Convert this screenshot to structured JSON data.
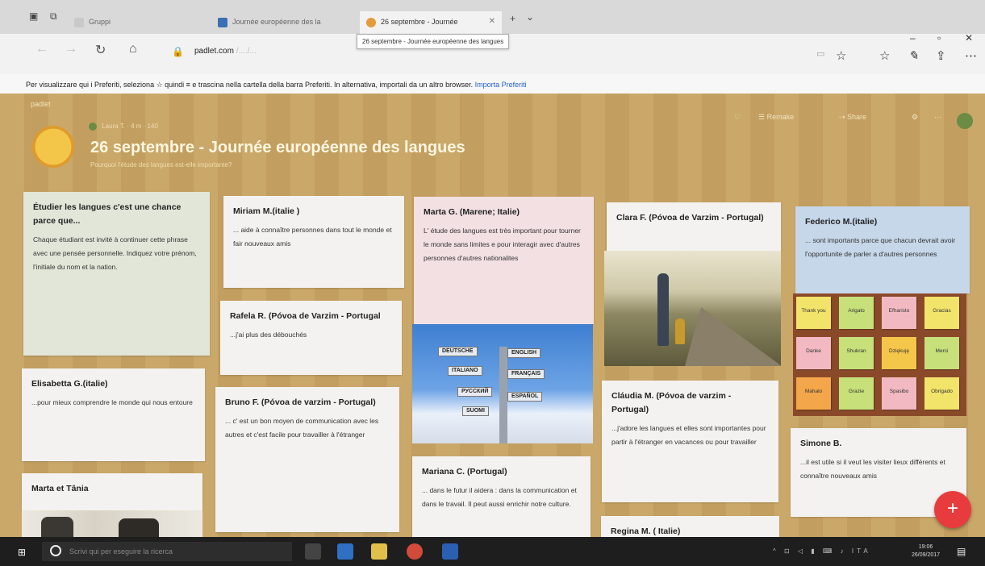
{
  "browser": {
    "tabs": [
      {
        "label": "Gruppi",
        "color": "#c9c9c9"
      },
      {
        "label": "Journée européenne des la",
        "color": "#3a6fb5"
      },
      {
        "label": "26 septembre - Journée",
        "color": "#e39b3b"
      }
    ],
    "tooltip": "26 septembre - Journée européenne des langues",
    "url_domain": "padlet.com",
    "url_path": "/..../...",
    "favorites_notice": "Per visualizzare qui i Preferiti, seleziona  ☆  quindi  ≡  e trascina nella cartella della barra Preferiti. In alternativa, importali da un altro browser.",
    "favorites_link": "Importa Preferiti"
  },
  "padlet": {
    "brand": "padlet",
    "author": "Laura T. · 4 m · 140",
    "title": "26 septembre - Journée européenne des langues",
    "subtitle": "Pourquoi l'étude des langues est-elle importante?",
    "tools": [
      "♡",
      "☰ Remake",
      "⇢ Share",
      "⚙",
      "⋯"
    ],
    "background_color": "#c8a463",
    "posts": {
      "intro": {
        "title": "Étudier les langues c'est une chance parce que...",
        "body": "Chaque étudiant est invité à continuer cette phrase avec une pensée personnelle. Indiquez votre prénom, l'initiale du nom et la nation."
      },
      "elisabetta": {
        "title": "Elisabetta G.(italie)",
        "body": "...pour mieux comprendre le monde qui nous entoure"
      },
      "marta_tania": {
        "title": "Marta et Tânia"
      },
      "miriam": {
        "title": "Miriam M.(italie )",
        "body": "... aide à connaître personnes dans tout le monde  et fair nouveaux amis"
      },
      "rafela": {
        "title": "Rafela R. (Póvoa de Varzim - Portugal",
        "body": "...j'ai plus des débouchés"
      },
      "bruno": {
        "title": "Bruno F. (Póvoa de varzim - Portugal)",
        "body": "... c' est un bon moyen de communication avec les autres et c'est facile pour travailler à l'étranger"
      },
      "marta_g": {
        "title": "Marta G. (Marene; Italie)",
        "body": "L' étude des langues est très important pour tourner le monde sans limites e pour interagir avec d'autres personnes d'autres nationalites"
      },
      "signpost_labels": [
        "DEUTSCHE",
        "ENGLISH",
        "ITALIANO",
        "FRANÇAIS",
        "РУССКИЙ",
        "ESPAÑOL",
        "SUOMI"
      ],
      "mariana": {
        "title": "Mariana C. (Portugal)",
        "body": "... dans le futur il aidera : dans la communication et dans le travail. Il peut aussi enrichir notre culture."
      },
      "clara": {
        "title": "Clara F. (Póvoa de Varzim - Portugal)"
      },
      "claudia": {
        "title": "Cláudia M. (Póvoa de varzim - Portugal)",
        "body": "...j'adore les langues et elles sont importantes pour partir à l'étranger en vacances ou pour travailler"
      },
      "regina": {
        "title": "Regina M. ( Italie)"
      },
      "federico": {
        "title": "Federico M.(italie)",
        "body": "... sont importants parce que chacun devrait avoir l'opportunite de parler a d'autres personnes"
      },
      "sticky_notes": [
        "Thank you",
        "Arigato",
        "Efharisto",
        "Gracias",
        "Danke",
        "Shukran",
        "Dziękuję",
        "Merci",
        "Mahalo",
        "Grazie",
        "Spasibo",
        "Obrigado"
      ],
      "simone": {
        "title": "Simone B.",
        "body": "...il est utile si il veut les visiter lieux différents et connaître nouveaux amis"
      }
    },
    "fab": "+"
  },
  "taskbar": {
    "search_placeholder": "Scrivi qui per eseguire la ricerca",
    "tray": "^ ⊡ ◁ ▮ ⌨ ♪ ITA",
    "time": "19:06",
    "date": "26/09/2017"
  }
}
